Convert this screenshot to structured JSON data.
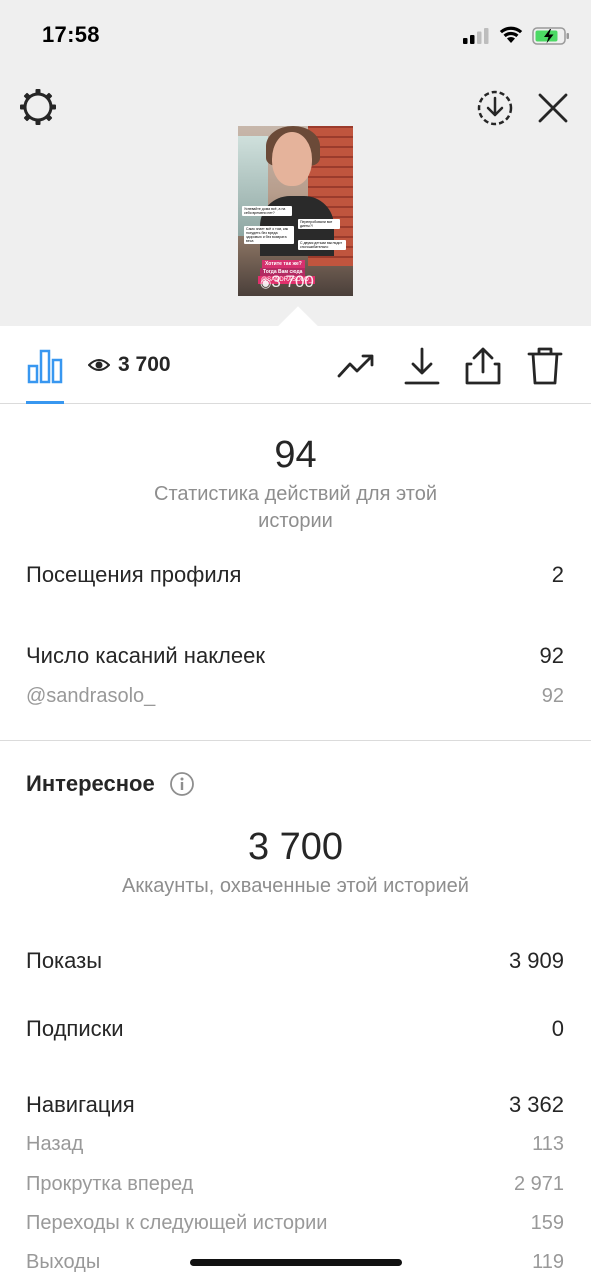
{
  "status_bar": {
    "time": "17:58"
  },
  "story_preview": {
    "sticker_texts": [
      "Успевайте дома всё, а на себя времени нет?",
      "Перепробовали все диеты?!",
      "Само знает всё о том, как похудеть без вреда здоровью и без возврата веса",
      "С двумя детьми выглядит сногсшибательно",
      "Хотите так же?",
      "Тогда Вам сюда",
      "@SANDRASOLO_"
    ],
    "views_overlay": "3 700"
  },
  "toolbar": {
    "views_count": "3 700"
  },
  "actions": {
    "total": "94",
    "caption": "Статистика действий для этой истории",
    "rows": [
      {
        "label": "Посещения профиля",
        "value": "2"
      },
      {
        "label": "Число касаний наклеек",
        "value": "92"
      },
      {
        "label": "@sandrasolo_",
        "value": "92"
      }
    ]
  },
  "discovery": {
    "title": "Интересное",
    "reach": "3 700",
    "caption": "Аккаунты, охваченные этой историей",
    "rows": [
      {
        "label": "Показы",
        "value": "3 909"
      },
      {
        "label": "Подписки",
        "value": "0"
      },
      {
        "label": "Навигация",
        "value": "3 362"
      },
      {
        "label": "Назад",
        "value": "113"
      },
      {
        "label": "Прокрутка вперед",
        "value": "2 971"
      },
      {
        "label": "Переходы к следующей истории",
        "value": "159"
      },
      {
        "label": "Выходы",
        "value": "119"
      }
    ]
  },
  "colors": {
    "accent": "#3897f0",
    "text": "#262626",
    "muted": "#8e8e8e",
    "background_top": "#efefef"
  }
}
